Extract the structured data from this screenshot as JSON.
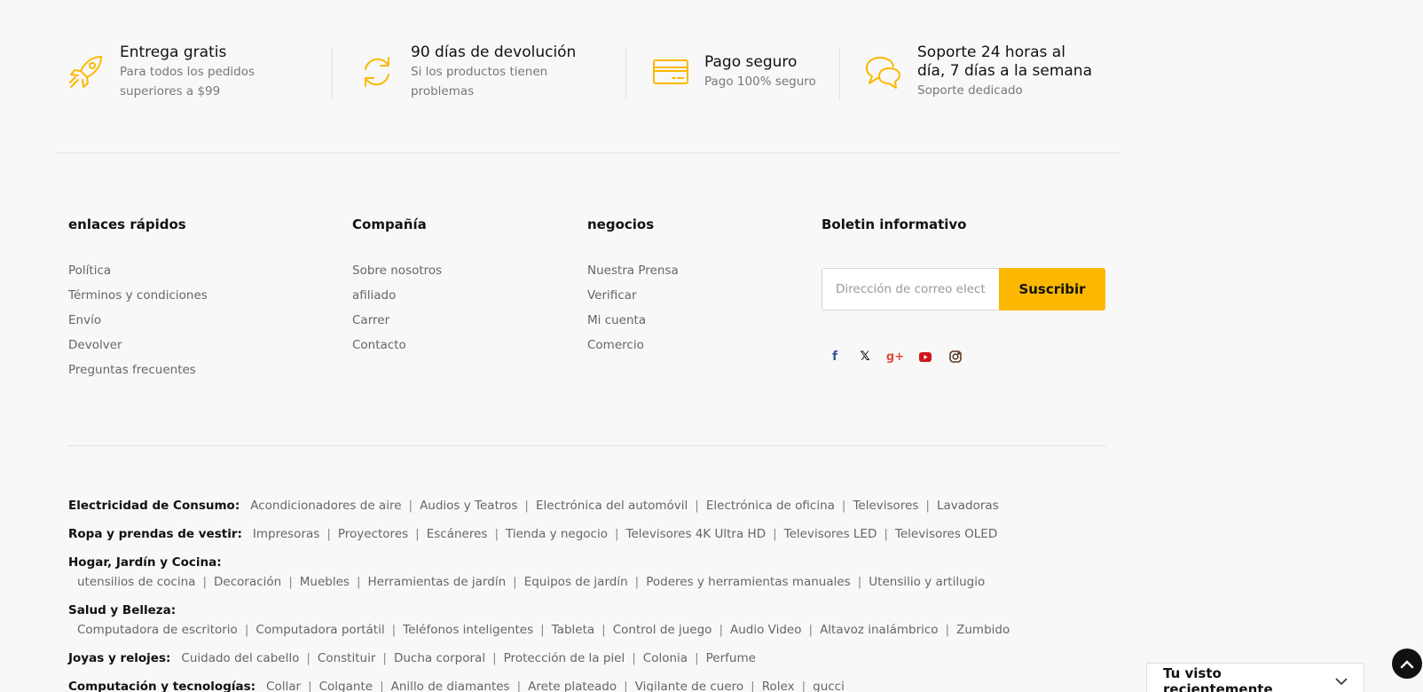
{
  "features": [
    {
      "icon": "rocket-icon",
      "title": "Entrega gratis",
      "subtitle_line1": "Para todos los pedidos",
      "subtitle_line2": "superiores a $99"
    },
    {
      "icon": "refresh-icon",
      "title": "90 días de devolución",
      "subtitle_line1": "Si los productos tienen",
      "subtitle_line2": "problemas"
    },
    {
      "icon": "credit-card-icon",
      "title": "Pago seguro",
      "subtitle_line1": "Pago 100% seguro"
    },
    {
      "icon": "chat-bubbles-icon",
      "title_line1": "Soporte 24 horas al",
      "title_line2": "día, 7 días a la semana",
      "subtitle_line1": "Soporte dedicado"
    }
  ],
  "footer": {
    "quick_links": {
      "title": "enlaces rápidos",
      "items": [
        "Política",
        "Términos y condiciones",
        "Envío",
        "Devolver",
        "Preguntas frecuentes"
      ]
    },
    "company": {
      "title": "Compañía",
      "items": [
        "Sobre nosotros",
        "afiliado",
        "Carrer",
        "Contacto"
      ]
    },
    "business": {
      "title": "negocios",
      "items": [
        "Nuestra Prensa",
        "Verificar",
        "Mi cuenta",
        "Comercio"
      ]
    },
    "newsletter": {
      "title": "Boletin informativo",
      "placeholder": "Dirección de correo electrónico",
      "button": "Suscribir"
    },
    "social": [
      {
        "name": "facebook-icon",
        "glyph": "f",
        "color": "#3b5998"
      },
      {
        "name": "x-twitter-icon",
        "glyph": "𝕏",
        "color": "#000000"
      },
      {
        "name": "google-plus-icon",
        "glyph": "g+",
        "color": "#dd4b39"
      },
      {
        "name": "youtube-icon",
        "glyph": "▶",
        "color": "#cc181e"
      },
      {
        "name": "instagram-icon",
        "glyph": "◎",
        "color": "#5a3a22"
      }
    ]
  },
  "categories": [
    {
      "title": "Electricidad de Consumo:",
      "items": [
        "Acondicionadores de aire",
        "Audios y Teatros",
        "Electrónica del automóvil",
        "Electrónica de oficina",
        "Televisores",
        "Lavadoras"
      ]
    },
    {
      "title": "Ropa y prendas de vestir:",
      "items": [
        "Impresoras",
        "Proyectores",
        "Escáneres",
        "Tienda y negocio",
        "Televisores 4K Ultra HD",
        "Televisores LED",
        "Televisores OLED"
      ]
    },
    {
      "title": "Hogar, Jardín y Cocina:",
      "wrap": true,
      "items": [
        "utensilios de cocina",
        "Decoración",
        "Muebles",
        "Herramientas de jardín",
        "Equipos de jardín",
        "Poderes y herramientas manuales",
        "Utensilio y artilugio"
      ]
    },
    {
      "title": "Salud y Belleza:",
      "wrap": true,
      "items": [
        "Computadora de escritorio",
        "Computadora portátil",
        "Teléfonos inteligentes",
        "Tableta",
        "Control de juego",
        "Audio Video",
        "Altavoz inalámbrico",
        "Zumbido"
      ]
    },
    {
      "title": "Joyas y relojes:",
      "items": [
        "Cuidado del cabello",
        "Constituir",
        "Ducha corporal",
        "Protección de la piel",
        "Colonia",
        "Perfume"
      ]
    },
    {
      "title": "Computación y tecnologías:",
      "items": [
        "Collar",
        "Colgante",
        "Anillo de diamantes",
        "Arete plateado",
        "Vigilante de cuero",
        "Rolex",
        "gucci"
      ]
    }
  ],
  "recently_viewed": {
    "label": "Tu visto recientemente"
  },
  "colors": {
    "accent": "#fcb800",
    "text_muted": "#666666"
  }
}
